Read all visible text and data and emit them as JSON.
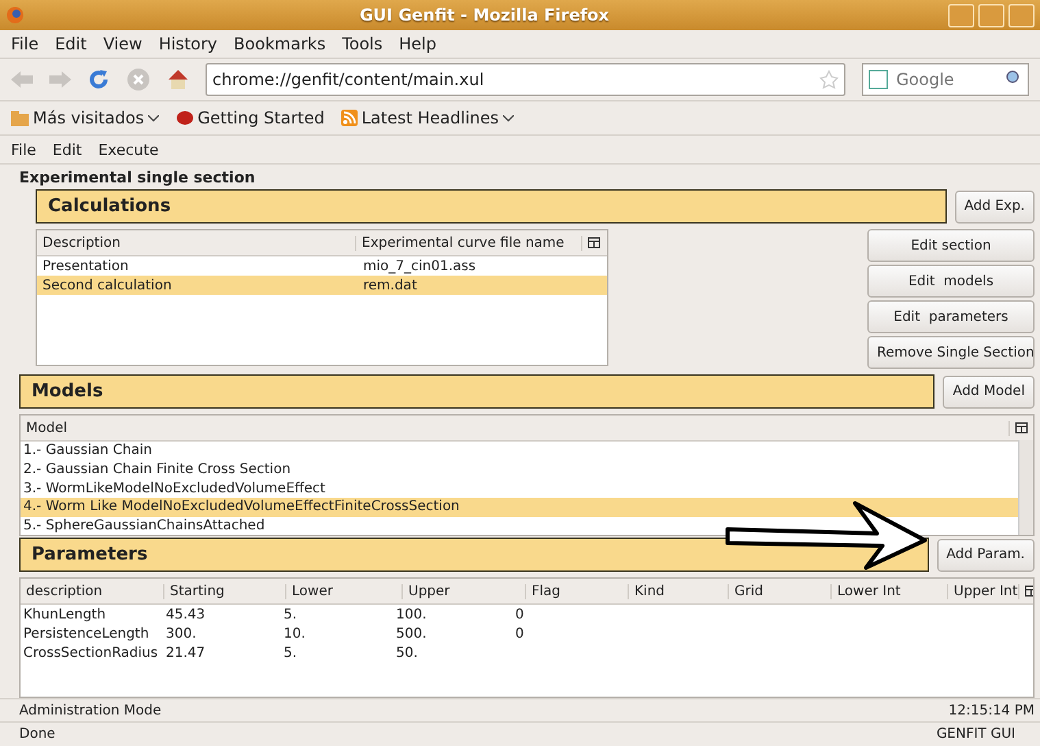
{
  "window": {
    "title": "GUI Genfit - Mozilla Firefox"
  },
  "browser_menu": [
    "File",
    "Edit",
    "View",
    "History",
    "Bookmarks",
    "Tools",
    "Help"
  ],
  "address": {
    "value": "chrome://genfit/content/main.xul"
  },
  "search": {
    "placeholder": "Google"
  },
  "bookmarks": [
    {
      "kind": "folder",
      "label": "Más visitados",
      "dropdown": true
    },
    {
      "kind": "page",
      "label": "Getting Started",
      "dropdown": false
    },
    {
      "kind": "feed",
      "label": "Latest Headlines",
      "dropdown": true
    }
  ],
  "app_menu": [
    "File",
    "Edit",
    "Execute"
  ],
  "section_title": "Experimental single section",
  "calculations": {
    "title": "Calculations",
    "add_button": "Add Exp.",
    "columns": [
      "Description",
      "Experimental curve file name"
    ],
    "rows": [
      {
        "cells": [
          "Presentation",
          "mio_7_cin01.ass"
        ],
        "selected": false
      },
      {
        "cells": [
          "Second calculation",
          "rem.dat"
        ],
        "selected": true
      }
    ],
    "buttons": [
      "Edit section",
      "Edit  models",
      "Edit  parameters",
      "Remove Single Section"
    ]
  },
  "models": {
    "title": "Models",
    "add_button": "Add Model",
    "columns": [
      "Model"
    ],
    "rows": [
      {
        "label": "1.- Gaussian Chain",
        "selected": false
      },
      {
        "label": "2.- Gaussian Chain Finite Cross Section",
        "selected": false
      },
      {
        "label": "3.- WormLikeModelNoExcludedVolumeEffect",
        "selected": false
      },
      {
        "label": "4.- Worm Like ModelNoExcludedVolumeEffectFiniteCrossSection",
        "selected": true
      },
      {
        "label": "5.- SphereGaussianChainsAttached",
        "selected": false
      }
    ]
  },
  "parameters": {
    "title": "Parameters",
    "add_button": "Add Param.",
    "columns": [
      "description",
      "Starting",
      "Lower",
      "Upper",
      "Flag",
      "Kind",
      "Grid",
      "Lower Int",
      "Upper Int"
    ],
    "rows": [
      [
        "KhunLength",
        "45.43",
        "5.",
        "100.",
        "0"
      ],
      [
        "PersistenceLength",
        "300.",
        "10.",
        "500.",
        "0"
      ],
      [
        "CrossSectionRadius",
        "21.47",
        "5.",
        "50."
      ]
    ]
  },
  "app_status": {
    "mode": "Administration Mode",
    "time": "12:15:14 PM"
  },
  "status_bar": {
    "text": "Done",
    "right": "GENFIT GUI"
  }
}
